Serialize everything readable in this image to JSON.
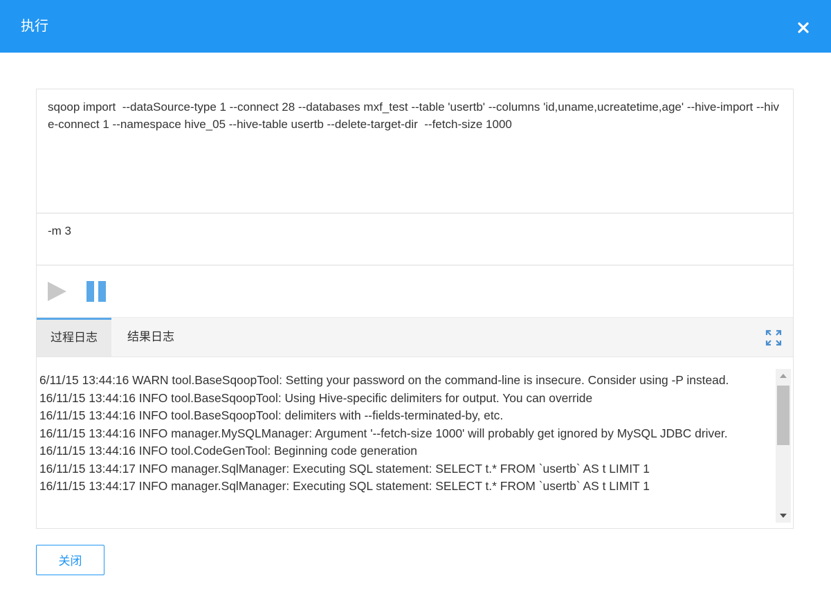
{
  "dialog": {
    "title": "执行",
    "close_icon": "close-icon"
  },
  "command": {
    "text": "sqoop import  --dataSource-type 1 --connect 28 --databases mxf_test --table 'usertb' --columns 'id,uname,ucreatetime,age' --hive-import --hive-connect 1 --namespace hive_05 --hive-table usertb --delete-target-dir  --fetch-size 1000"
  },
  "args": {
    "text": "-m 3"
  },
  "controls": {
    "play_icon": "play-icon",
    "pause_icon": "pause-icon",
    "play_color": "#c8c8c8",
    "pause_color": "#5aa8e8"
  },
  "tabs": [
    {
      "label": "过程日志",
      "active": true
    },
    {
      "label": "结果日志",
      "active": false
    }
  ],
  "expand_icon": "fullscreen-icon",
  "log": {
    "lines": [
      "6/11/15 13:44:16 WARN tool.BaseSqoopTool: Setting your password on the command-line is insecure. Consider using -P instead.",
      "16/11/15 13:44:16 INFO tool.BaseSqoopTool: Using Hive-specific delimiters for output. You can override",
      "16/11/15 13:44:16 INFO tool.BaseSqoopTool: delimiters with --fields-terminated-by, etc.",
      "16/11/15 13:44:16 INFO manager.MySQLManager: Argument '--fetch-size 1000' will probably get ignored by MySQL JDBC driver.",
      "16/11/15 13:44:16 INFO tool.CodeGenTool: Beginning code generation",
      "16/11/15 13:44:17 INFO manager.SqlManager: Executing SQL statement: SELECT t.* FROM `usertb` AS t LIMIT 1",
      "16/11/15 13:44:17 INFO manager.SqlManager: Executing SQL statement: SELECT t.* FROM `usertb` AS t LIMIT 1"
    ]
  },
  "footer": {
    "close_label": "关闭"
  },
  "colors": {
    "header": "#2196f3",
    "accent": "#2196f3"
  }
}
